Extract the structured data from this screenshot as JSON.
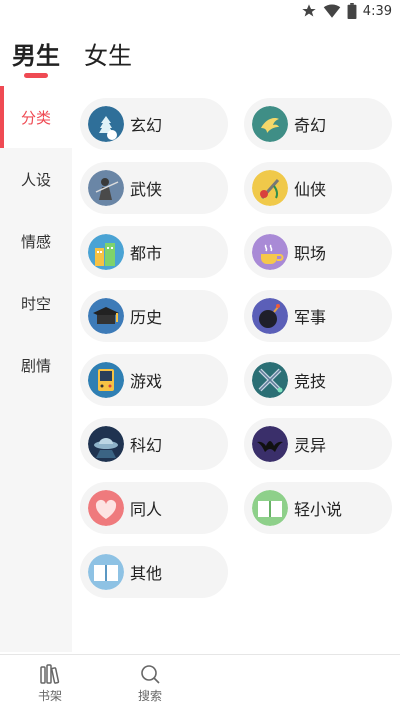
{
  "status_bar": {
    "time": "4:39"
  },
  "tabs": [
    {
      "label": "男生",
      "active": true
    },
    {
      "label": "女生",
      "active": false
    }
  ],
  "sidebar": {
    "items": [
      {
        "label": "分类",
        "active": true
      },
      {
        "label": "人设",
        "active": false
      },
      {
        "label": "情感",
        "active": false
      },
      {
        "label": "时空",
        "active": false
      },
      {
        "label": "剧情",
        "active": false
      }
    ]
  },
  "categories": [
    {
      "label": "玄幻",
      "icon": "xuanhuan-icon",
      "color": "#2f6f99"
    },
    {
      "label": "奇幻",
      "icon": "qihuan-icon",
      "color": "#3f8e86"
    },
    {
      "label": "武侠",
      "icon": "wuxia-icon",
      "color": "#6a86a6"
    },
    {
      "label": "仙侠",
      "icon": "xianxia-icon",
      "color": "#f0c94a"
    },
    {
      "label": "都市",
      "icon": "dushi-icon",
      "color": "#4aa3d4"
    },
    {
      "label": "职场",
      "icon": "zhichang-icon",
      "color": "#a98ad6"
    },
    {
      "label": "历史",
      "icon": "lishi-icon",
      "color": "#3d7bb8"
    },
    {
      "label": "军事",
      "icon": "junshi-icon",
      "color": "#5b5fb8"
    },
    {
      "label": "游戏",
      "icon": "youxi-icon",
      "color": "#2f7fb3"
    },
    {
      "label": "竞技",
      "icon": "jingji-icon",
      "color": "#2b6f75"
    },
    {
      "label": "科幻",
      "icon": "kehuan-icon",
      "color": "#1f3350"
    },
    {
      "label": "灵异",
      "icon": "lingyi-icon",
      "color": "#3a2f6a"
    },
    {
      "label": "同人",
      "icon": "tongren-icon",
      "color": "#ef7a7d"
    },
    {
      "label": "轻小说",
      "icon": "qingxiaoshuo-icon",
      "color": "#8ed08a"
    },
    {
      "label": "其他",
      "icon": "qita-icon",
      "color": "#8ec2e4"
    }
  ],
  "bottom_nav": [
    {
      "label": "书架",
      "icon": "bookshelf-icon"
    },
    {
      "label": "搜索",
      "icon": "search-icon"
    }
  ]
}
